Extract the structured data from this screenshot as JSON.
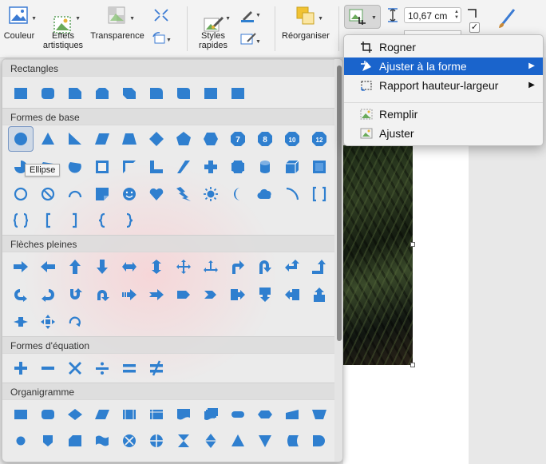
{
  "ribbon": {
    "buttons": [
      {
        "label": "Couleur"
      },
      {
        "label": "Effets\nartistiques"
      },
      {
        "label": "Transparence"
      },
      {
        "label": "Styles\nrapides"
      },
      {
        "label": "Réorganiser"
      }
    ],
    "height_value": "10,67 cm"
  },
  "gallery": {
    "sections": [
      {
        "title": "Rectangles"
      },
      {
        "title": "Formes de base"
      },
      {
        "title": "Flèches pleines"
      },
      {
        "title": "Formes d'équation"
      },
      {
        "title": "Organigramme"
      }
    ],
    "tooltip": "Ellipse",
    "shape_color": "#2f7fcf"
  },
  "menu": {
    "items": [
      {
        "label": "Rogner",
        "icon": "crop-icon"
      },
      {
        "label": "Ajuster à la forme",
        "icon": "shape-fit-icon",
        "submenu": true,
        "highlighted": true
      },
      {
        "label": "Rapport hauteur-largeur",
        "icon": "aspect-ratio-icon",
        "submenu": true
      },
      {
        "label": "Remplir",
        "icon": "fill-image-icon"
      },
      {
        "label": "Ajuster",
        "icon": "fit-image-icon"
      }
    ],
    "highlight_color": "#1a64cc"
  }
}
